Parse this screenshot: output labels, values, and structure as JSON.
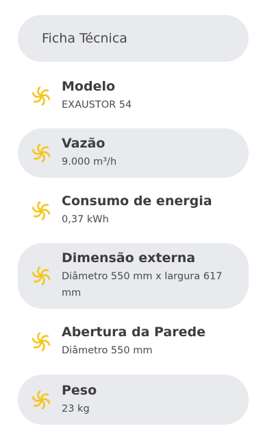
{
  "header": {
    "title": "Ficha Técnica"
  },
  "icon_name": "fan-icon",
  "icon_color": "#f5c518",
  "specs": [
    {
      "label": "Modelo",
      "value": "EXAUSTOR 54"
    },
    {
      "label": "Vazão",
      "value": "9.000 m³/h"
    },
    {
      "label": "Consumo de energia",
      "value": "0,37 kWh"
    },
    {
      "label": "Dimensão externa",
      "value": "Diâmetro 550 mm x largura 617 mm"
    },
    {
      "label": "Abertura da Parede",
      "value": "Diâmetro 550 mm"
    },
    {
      "label": "Peso",
      "value": "23 kg"
    }
  ]
}
